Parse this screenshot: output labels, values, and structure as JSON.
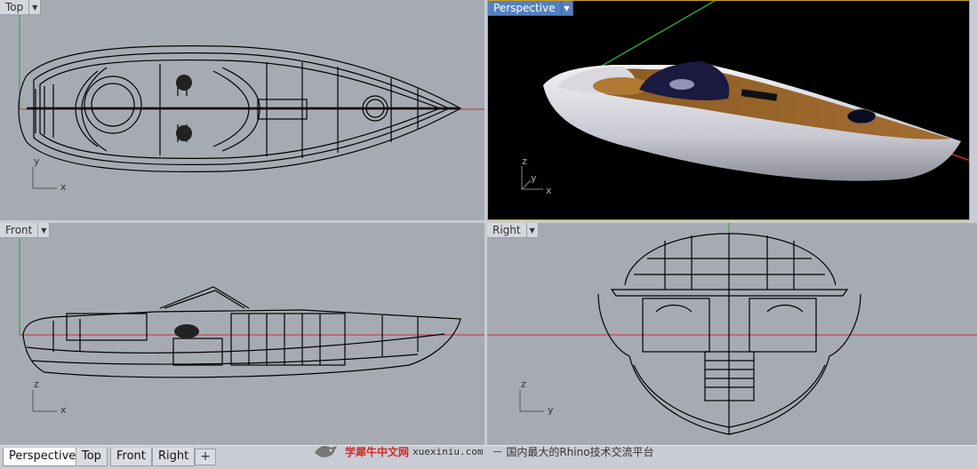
{
  "viewports": {
    "top": {
      "label": "Top",
      "axis_x": "x",
      "axis_y": "y"
    },
    "perspective": {
      "label": "Perspective",
      "axis_x": "x",
      "axis_y": "y",
      "axis_z": "z"
    },
    "front": {
      "label": "Front",
      "axis_x": "x",
      "axis_z": "z"
    },
    "right": {
      "label": "Right",
      "axis_y": "y",
      "axis_z": "z"
    }
  },
  "tabs": [
    "Perspective",
    "Top",
    "Front",
    "Right"
  ],
  "add_tab_symbol": "+",
  "active_tab": "Perspective",
  "watermark": {
    "brand": "学犀牛中文网",
    "url": "xuexiniu.com",
    "slogan": "－ 国内最大的Rhino技术交流平台"
  },
  "colors": {
    "viewport_bg": "#a6abb3",
    "perspective_bg": "#000000",
    "x_axis": "#c03030",
    "y_axis": "#30a030",
    "active_tab_label_bg": "#5580c0"
  }
}
